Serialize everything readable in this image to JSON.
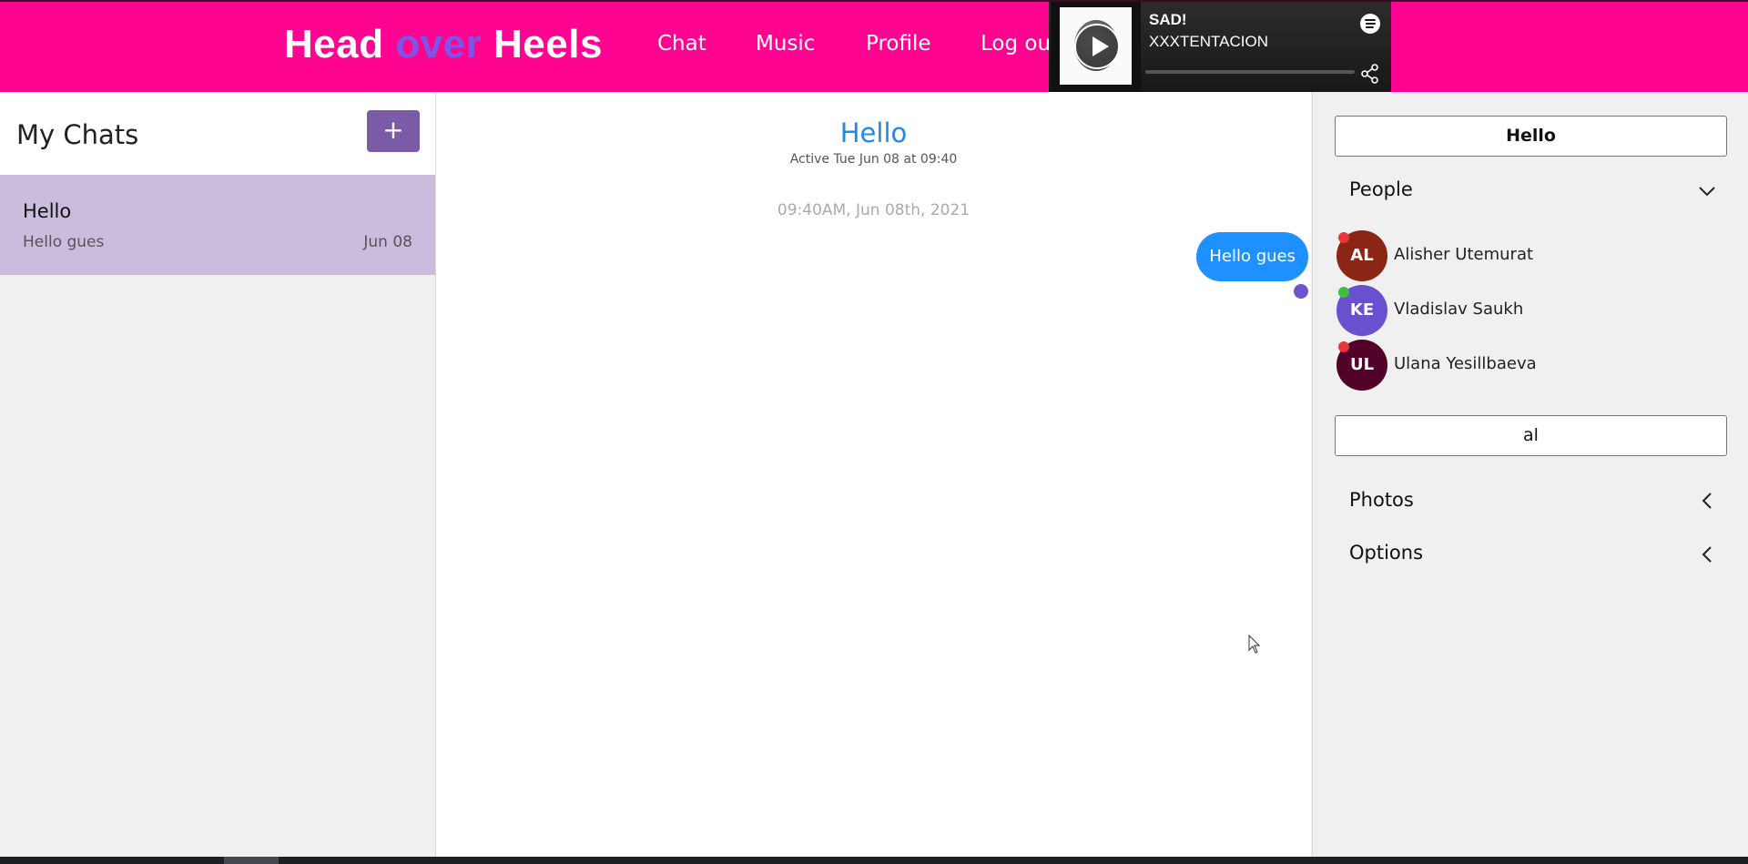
{
  "header": {
    "brand": {
      "part1": "Head ",
      "part2": "over",
      "part3": " Heels"
    },
    "nav": [
      "Chat",
      "Music",
      "Profile",
      "Log out"
    ]
  },
  "player": {
    "title": "SAD!",
    "artist": "XXXTENTACION",
    "progress_fraction": 0.0,
    "icons": [
      "play-icon",
      "spotify-icon",
      "share-icon"
    ]
  },
  "left_panel": {
    "title": "My Chats",
    "add_label": "+",
    "chats": [
      {
        "name": "Hello",
        "preview": "Hello gues",
        "date": "Jun 08"
      }
    ]
  },
  "conversation": {
    "title": "Hello",
    "subtitle": "Active Tue Jun 08 at 09:40",
    "timestamp": "09:40AM, Jun 08th, 2021",
    "messages": [
      {
        "text": "Hello gues",
        "from": "me"
      }
    ]
  },
  "right_panel": {
    "chat_name": "Hello",
    "people_label": "People",
    "people": [
      {
        "initials": "AL",
        "name": "Alisher Utemurat",
        "color": "#8b2616",
        "status": "offline",
        "status_color": "#e8343c"
      },
      {
        "initials": "KE",
        "name": "Vladislav Saukh",
        "color": "#6950cf",
        "status": "online",
        "status_color": "#3fbf3f"
      },
      {
        "initials": "UL",
        "name": "Ulana Yesillbaeva",
        "color": "#520228",
        "status": "offline",
        "status_color": "#e8343c"
      }
    ],
    "search_value": "al",
    "photos_label": "Photos",
    "options_label": "Options"
  },
  "colors": {
    "header_bg": "#ff0490",
    "brand_accent": "#7c55e8",
    "add_button": "#7b5aa6",
    "selected_chat": "#cbbbdd",
    "bubble": "#1e90ff",
    "title_blue": "#1f8ae8"
  }
}
